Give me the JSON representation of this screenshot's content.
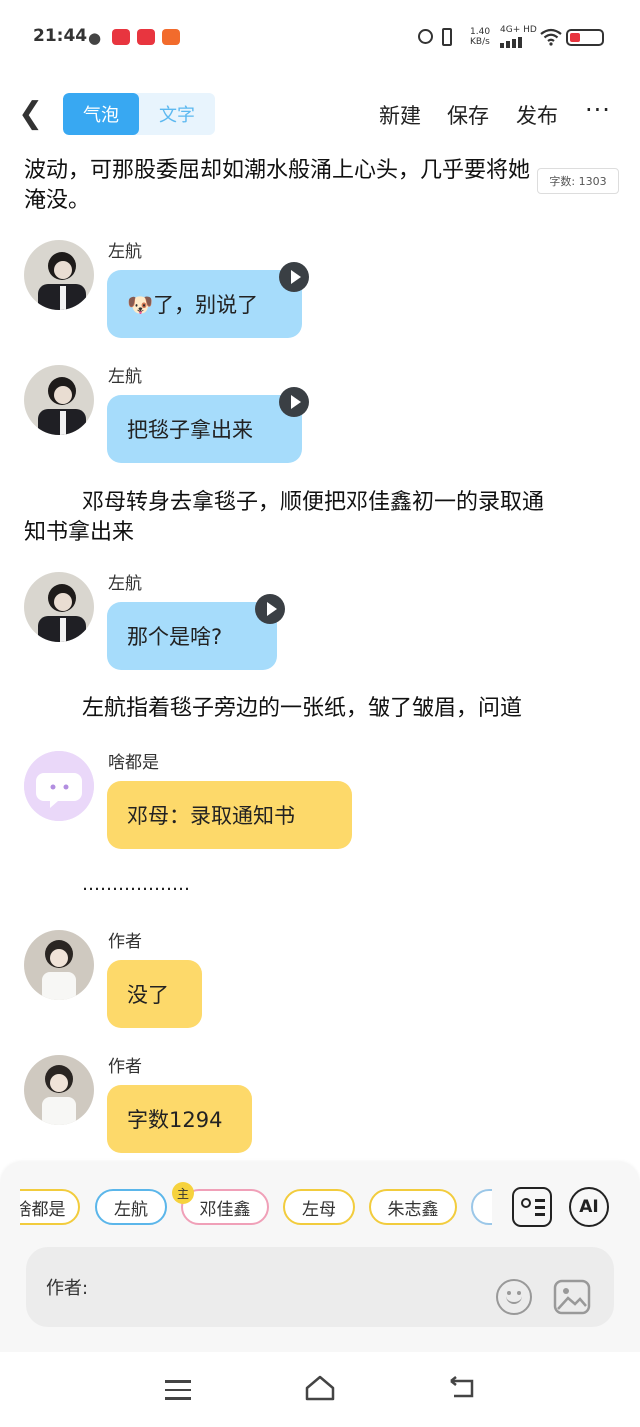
{
  "status_bar": {
    "time": "21:44",
    "net_speed_top": "1.40",
    "net_speed_bottom": "KB/s",
    "network": "4G+ HD",
    "app_icon_1": "wechat-icon",
    "app_icon_2": "app-red-icon"
  },
  "topbar": {
    "tab_bubble": "气泡",
    "tab_text": "文字",
    "new_label": "新建",
    "save_label": "保存",
    "publish_label": "发布",
    "more_label": "···"
  },
  "word_count": "字数: 1303",
  "content": {
    "para_top_line1": "波动，可那股委屈却如潮水般涌上心头，几乎要将她",
    "para_top_line2": "淹没。",
    "msg1": {
      "name": "左航",
      "text": "🐶了，别说了"
    },
    "msg2": {
      "name": "左航",
      "text": "把毯子拿出来"
    },
    "para2_line1": "邓母转身去拿毯子，顺便把邓佳鑫初一的录取通",
    "para2_line2": "知书拿出来",
    "msg3": {
      "name": "左航",
      "text": "那个是啥?"
    },
    "para3": "左航指着毯子旁边的一张纸，皱了皱眉，问道",
    "msg4": {
      "name": "啥都是",
      "text": "邓母：录取通知书"
    },
    "ellipsis": "………………",
    "msg5": {
      "name": "作者",
      "text": "没了"
    },
    "msg6": {
      "name": "作者",
      "text": "字数1294"
    }
  },
  "characters": {
    "chip1": "啥都是",
    "chip2": "左航",
    "chip3": "邓佳鑫",
    "chip3_badge": "主",
    "chip4": "左母",
    "chip5": "朱志鑫",
    "ai_label": "AI"
  },
  "input": {
    "speaker": "作者:"
  },
  "colors": {
    "accent": "#38a8f2",
    "bubble_blue": "#a6dcfb",
    "bubble_yellow": "#fdd96a"
  }
}
